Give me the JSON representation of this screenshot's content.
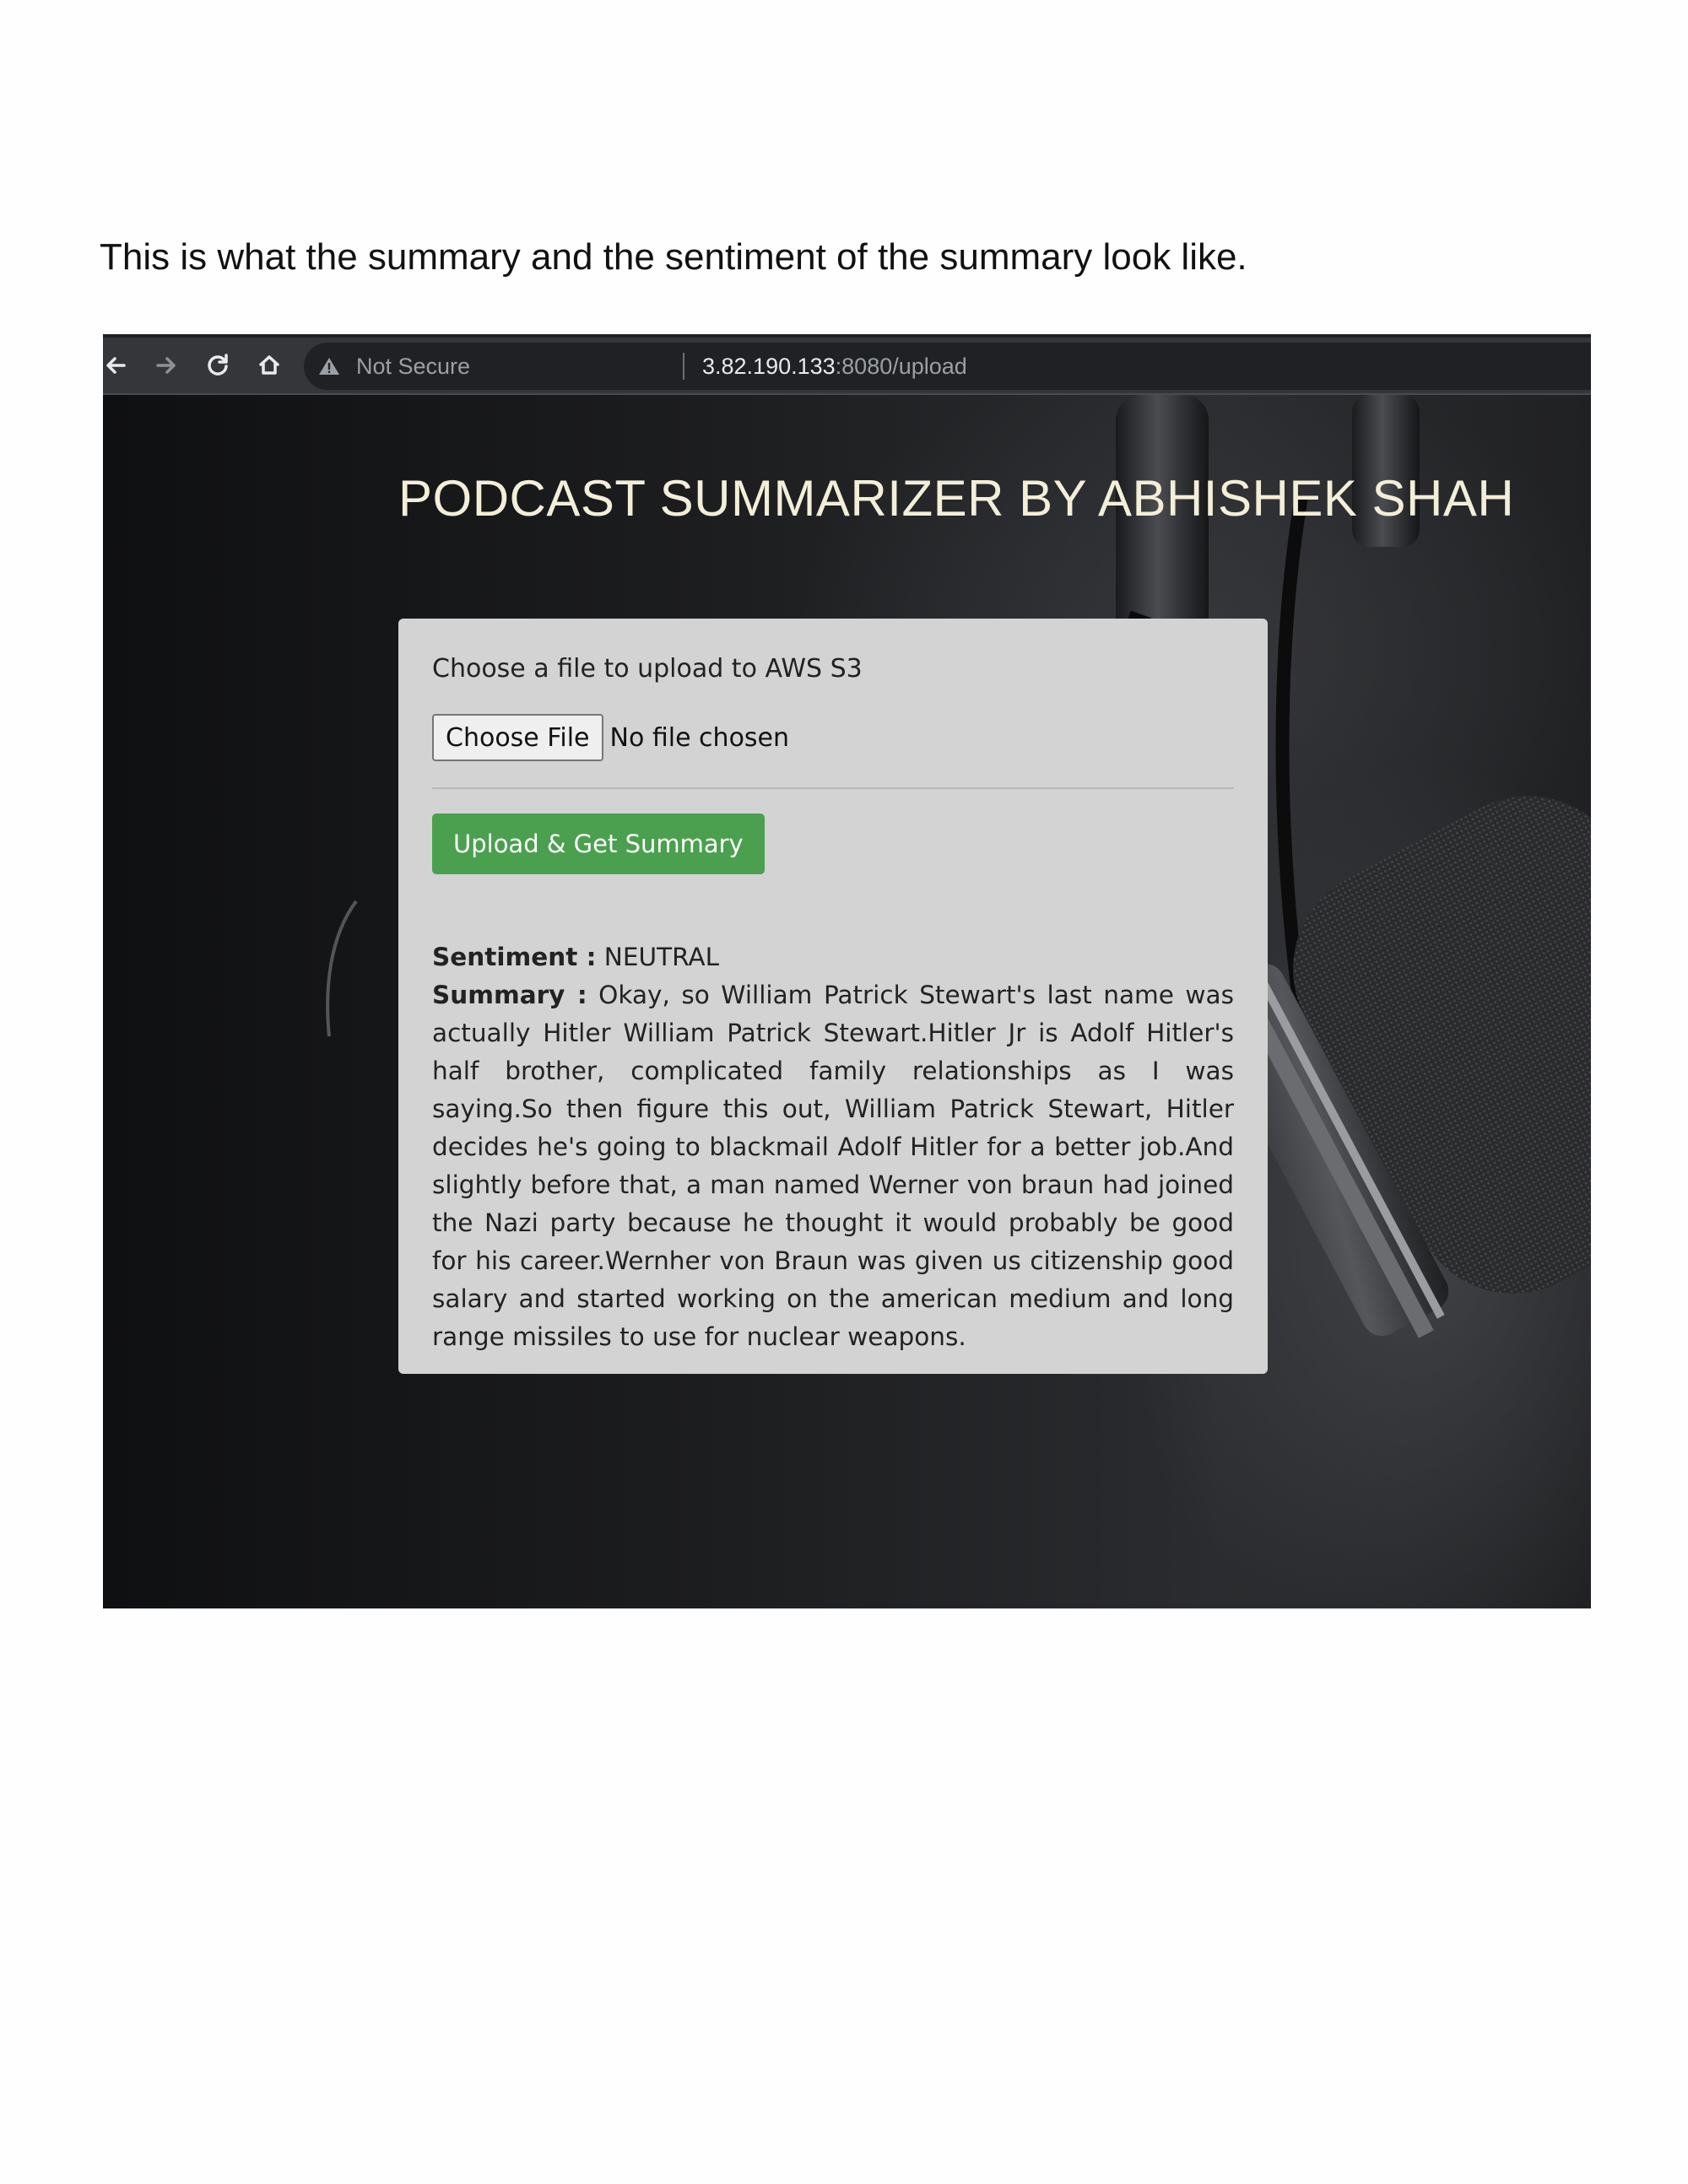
{
  "caption": "This is what the summary and the sentiment of the summary look like.",
  "browser": {
    "security_label": "Not Secure",
    "url_host": "3.82.190.133",
    "url_path": ":8080/upload"
  },
  "page": {
    "title": "PODCAST SUMMARIZER BY ABHISHEK SHAH",
    "upload_label": "Choose a file to upload to AWS S3",
    "choose_file_label": "Choose File",
    "no_file_text": "No file chosen",
    "submit_label": "Upload & Get Summary",
    "sentiment_label": "Sentiment :",
    "sentiment_value": "NEUTRAL",
    "summary_label": "Summary :",
    "summary_text": "Okay, so William Patrick Stewart's last name was actually Hitler William Patrick Stewart.Hitler Jr is Adolf Hitler's half brother, complicated family relationships as I was saying.So then figure this out, William Patrick Stewart, Hitler decides he's going to blackmail Adolf Hitler for a better job.And slightly before that, a man named Werner von braun had joined the Nazi party because he thought it would probably be good for his career.Wernher von Braun was given us citizenship good salary and started working on the american medium and long range missiles to use for nuclear weapons."
  },
  "colors": {
    "title": "#f3eed8",
    "card_bg": "#d3d3d3",
    "button_green": "#4aa04e",
    "browser_bar": "#35363a"
  },
  "icons": [
    "back-arrow-icon",
    "forward-arrow-icon",
    "reload-icon",
    "home-icon",
    "warning-icon"
  ]
}
